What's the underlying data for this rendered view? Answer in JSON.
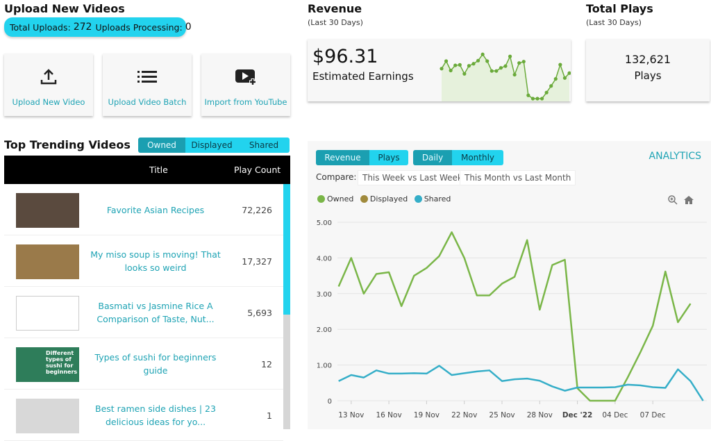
{
  "upload": {
    "title": "Upload New Videos",
    "total_label": "Total Uploads:",
    "total": "272",
    "processing_label": "Uploads Processing:",
    "processing": "0",
    "actions": [
      {
        "label": "Upload New Video",
        "icon": "upload-icon"
      },
      {
        "label": "Upload Video Batch",
        "icon": "list-icon"
      },
      {
        "label": "Import from YouTube",
        "icon": "video-add-icon"
      }
    ]
  },
  "revenue": {
    "title": "Revenue",
    "period": "(Last 30 Days)",
    "amount": "$96.31",
    "caption": "Estimated Earnings"
  },
  "plays": {
    "title": "Total Plays",
    "period": "(Last 30 Days)",
    "count": "132,621",
    "caption": "Plays"
  },
  "trending": {
    "title": "Top Trending Videos",
    "tabs": [
      "Owned",
      "Displayed",
      "Shared"
    ],
    "active_tab": "Owned",
    "columns": [
      "Title",
      "Play Count"
    ],
    "rows": [
      {
        "title": "Favorite Asian Recipes",
        "count": "72,226",
        "thumb": "#5a4a3e"
      },
      {
        "title": "My miso soup is moving! That looks so weird",
        "count": "17,327",
        "thumb": "#9a7a4a"
      },
      {
        "title": "Basmati vs Jasmine Rice A Comparison of Taste, Nut...",
        "count": "5,693",
        "thumb": "broken"
      },
      {
        "title": "Types of sushi for beginners guide",
        "count": "12",
        "thumb": "#2e7d5a",
        "thumb_text": "Different types of sushi for beginners"
      },
      {
        "title": "Best ramen side dishes | 23 delicious ideas for yo...",
        "count": "1",
        "thumb": "#d8d8d8"
      }
    ]
  },
  "analytics": {
    "title": "ANALYTICS",
    "metric_tabs": [
      "Revenue",
      "Plays"
    ],
    "active_metric": "Revenue",
    "period_tabs": [
      "Daily",
      "Monthly"
    ],
    "active_period": "Daily",
    "compare_label": "Compare:",
    "compare_options": [
      "This Week vs Last Week",
      "This Month vs Last Month"
    ]
  },
  "colors": {
    "accent": "#22d3ee",
    "teal": "#1ea3b4",
    "owned": "#7ab648",
    "displayed": "#a08a3c",
    "shared": "#35aec8"
  },
  "chart_data": {
    "type": "line",
    "xlabel": "",
    "ylabel": "",
    "ylim": [
      0,
      5
    ],
    "grid": true,
    "legend": "top-left",
    "yticks": [
      "0",
      "1.00",
      "2.00",
      "3.00",
      "4.00",
      "5.00"
    ],
    "xticks": [
      "13 Nov",
      "16 Nov",
      "19 Nov",
      "22 Nov",
      "25 Nov",
      "28 Nov",
      "Dec '22",
      "04 Dec",
      "07 Dec"
    ],
    "x": [
      "12 Nov",
      "13 Nov",
      "14 Nov",
      "15 Nov",
      "16 Nov",
      "17 Nov",
      "18 Nov",
      "19 Nov",
      "20 Nov",
      "21 Nov",
      "22 Nov",
      "23 Nov",
      "24 Nov",
      "25 Nov",
      "26 Nov",
      "27 Nov",
      "28 Nov",
      "29 Nov",
      "30 Nov",
      "01 Dec",
      "02 Dec",
      "03 Dec",
      "04 Dec",
      "05 Dec",
      "06 Dec",
      "07 Dec",
      "08 Dec",
      "09 Dec",
      "10 Dec",
      "11 Dec"
    ],
    "series": [
      {
        "name": "Owned",
        "color": "#7ab648",
        "values": [
          3.2,
          4.0,
          3.0,
          3.55,
          3.6,
          2.65,
          3.5,
          3.72,
          4.05,
          4.72,
          4.0,
          2.95,
          2.95,
          3.28,
          3.47,
          4.5,
          2.55,
          3.8,
          3.95,
          0.35,
          0,
          0,
          0,
          0.65,
          1.35,
          2.1,
          3.62,
          2.2,
          2.72,
          null
        ]
      },
      {
        "name": "Displayed",
        "color": "#a08a3c",
        "values": []
      },
      {
        "name": "Shared",
        "color": "#35aec8",
        "values": [
          0.55,
          0.72,
          0.65,
          0.85,
          0.76,
          0.76,
          0.77,
          0.76,
          0.98,
          0.72,
          0.77,
          0.82,
          0.85,
          0.55,
          0.6,
          0.62,
          0.56,
          0.4,
          0.28,
          0.37,
          0.37,
          0.37,
          0.38,
          0.45,
          0.43,
          0.38,
          0.36,
          0.88,
          0.55,
          0
        ]
      }
    ]
  }
}
